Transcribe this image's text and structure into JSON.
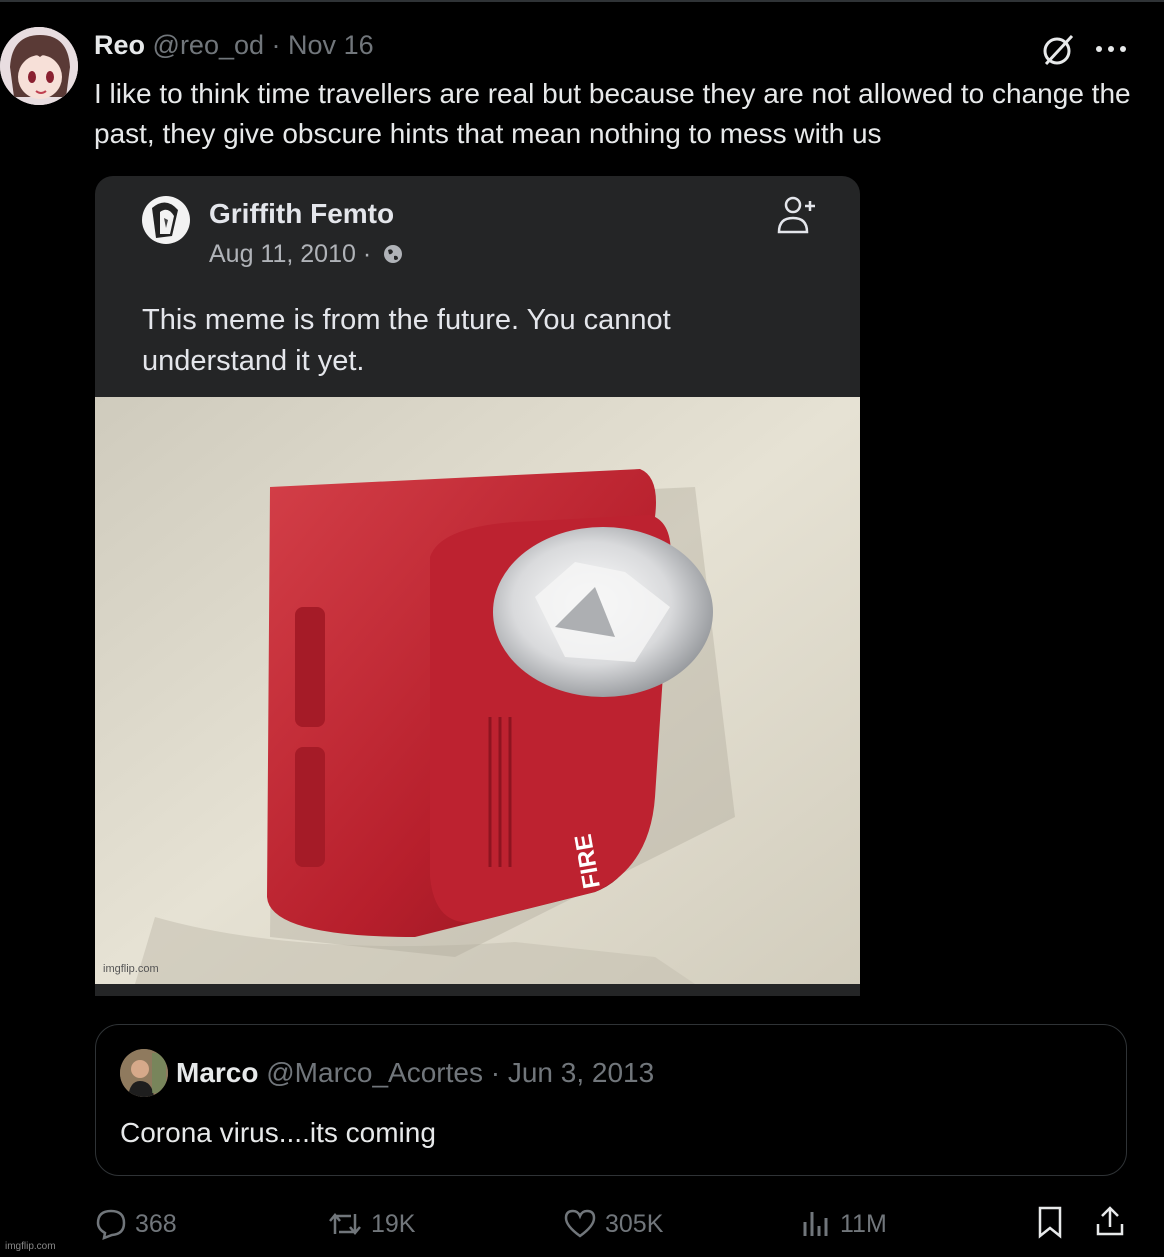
{
  "tweet": {
    "display_name": "Reo",
    "handle": "@reo_od",
    "separator": "·",
    "date": "Nov 16",
    "text": "I like to think time travellers are real but because they are not allowed to change the past, they give obscure hints that mean nothing to mess with us"
  },
  "embedded_post": {
    "name": "Griffith Femto",
    "date": "Aug 11, 2010 ·",
    "text": "This meme is from the future. You cannot understand it yet.",
    "image_watermark": "imgflip.com"
  },
  "quote": {
    "display_name": "Marco",
    "handle": "@Marco_Acortes",
    "separator": "·",
    "date": "Jun 3, 2013",
    "text": "Corona virus....its coming"
  },
  "actions": {
    "replies": "368",
    "reposts": "19K",
    "likes": "305K",
    "views": "11M"
  },
  "footer_watermark": "imgflip.com",
  "colors": {
    "background": "#000000",
    "text": "#e7e9ea",
    "muted": "#71767b",
    "fb_card": "#242526",
    "alarm_red": "#c0232d"
  },
  "icons": [
    "grok-icon",
    "more-icon",
    "add-friend-icon",
    "globe-icon",
    "reply-icon",
    "repost-icon",
    "like-icon",
    "views-icon",
    "bookmark-icon",
    "share-icon"
  ]
}
